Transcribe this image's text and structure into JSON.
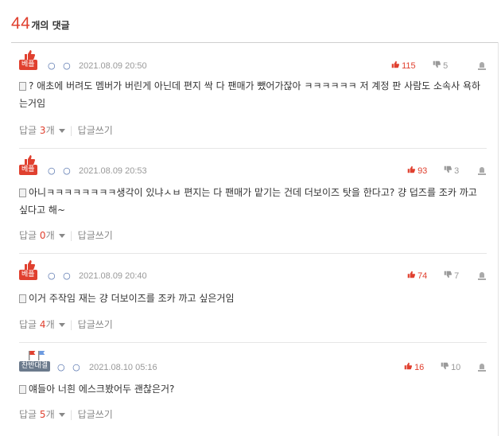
{
  "header": {
    "count": "44",
    "label": "개의 댓글"
  },
  "comments": [
    {
      "badge": "베플",
      "author": "○ ○",
      "date": "2021.08.09 20:50",
      "up": "115",
      "down": "5",
      "text": "? 애초에 버려도 멤버가 버린게 아닌데 편지 싹 다 팬매가 뺐어가잖아 ㅋㅋㅋㅋㅋㅋ 저 계정 판 사람도 소속사 욕하는거임",
      "reply_label": "답글",
      "reply_count": "3",
      "reply_unit": "개",
      "write_label": "답글쓰기"
    },
    {
      "badge": "베플",
      "author": "○ ○",
      "date": "2021.08.09 20:53",
      "up": "93",
      "down": "3",
      "text": "아니ㅋㅋㅋㅋㅋㅋㅋㅋ생각이 있냐ㅅㅂ 편지는 다 팬매가 맡기는 건데 더보이즈 탓을 한다고? 걍 덥즈를 조카 까고 싶다고 해~",
      "reply_label": "답글",
      "reply_count": "0",
      "reply_unit": "개",
      "write_label": "답글쓰기"
    },
    {
      "badge": "베플",
      "author": "○ ○",
      "date": "2021.08.09 20:40",
      "up": "74",
      "down": "7",
      "text": "이거 주작임 재는 걍 더보이즈를 조카 까고 싶은거임",
      "reply_label": "답글",
      "reply_count": "4",
      "reply_unit": "개",
      "write_label": "답글쓰기"
    },
    {
      "badge": "찬반대결",
      "author": "○ ○",
      "date": "2021.08.10 05:16",
      "up": "16",
      "down": "10",
      "text": "얘들아 너흰 에스크봤어두 괜찮은거?",
      "reply_label": "답글",
      "reply_count": "5",
      "reply_unit": "개",
      "write_label": "답글쓰기"
    }
  ],
  "colors": {
    "accent": "#e0402f",
    "muted": "#999999",
    "author": "#4a6aa8"
  },
  "icons": {
    "best": "thumbs-up-icon",
    "versus": "flags-icon",
    "up": "thumbs-up-icon",
    "down": "thumbs-down-icon",
    "report": "siren-icon",
    "doc": "document-icon"
  }
}
